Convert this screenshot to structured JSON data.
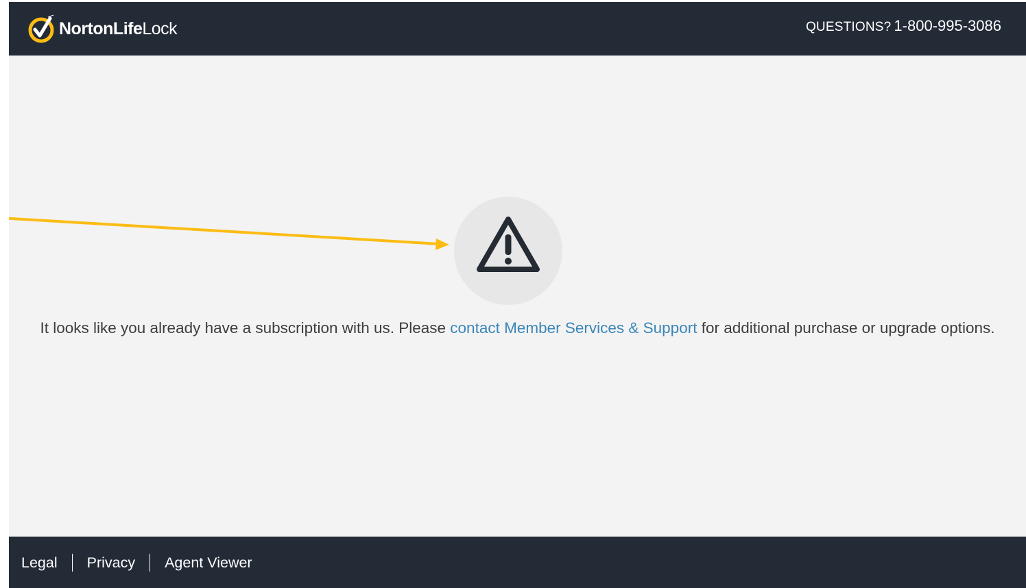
{
  "header": {
    "logo": {
      "brand_bold": "NortonLife",
      "brand_light": "Lock"
    },
    "questions_label": "QUESTIONS?",
    "phone": "1-800-995-3086"
  },
  "main": {
    "icon": "warning-triangle-icon",
    "message_before": "It looks like you already have a subscription with us. Please ",
    "message_link": "contact Member Services & Support",
    "message_after": " for additional purchase or upgrade options.",
    "annotation": "arrow-annotation"
  },
  "footer": {
    "links": [
      {
        "label": "Legal"
      },
      {
        "label": "Privacy"
      },
      {
        "label": "Agent Viewer"
      }
    ]
  },
  "colors": {
    "header_bg": "#232b36",
    "body_bg": "#f3f3f3",
    "logo_yellow": "#fdbb12",
    "link_blue": "#3a86b8",
    "arrow_yellow": "#fbbc14"
  }
}
